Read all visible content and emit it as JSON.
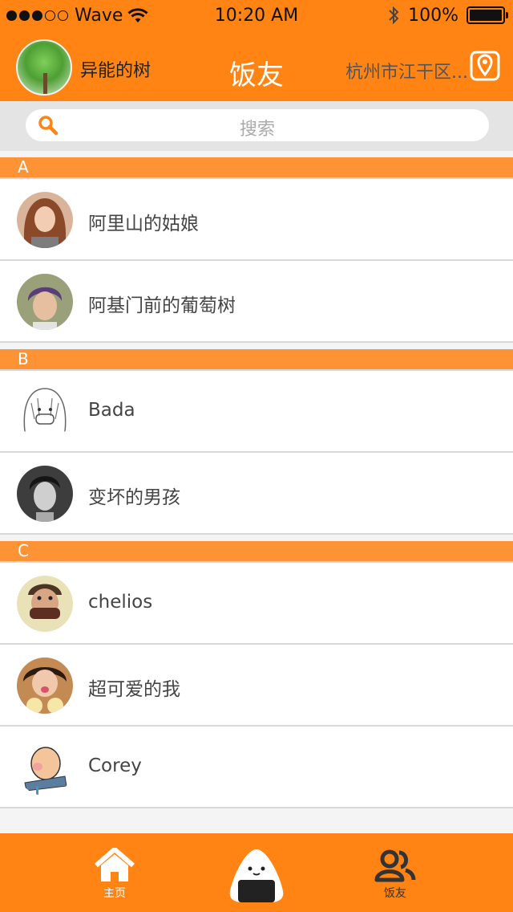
{
  "status_bar": {
    "carrier": "Wave",
    "time": "10:20  AM",
    "battery": "100%"
  },
  "nav": {
    "username": "异能的树",
    "title": "饭友",
    "location": "杭州市江干区..."
  },
  "search": {
    "placeholder": "搜索"
  },
  "sections": [
    {
      "letter": "A",
      "contacts": [
        "阿里山的姑娘",
        "阿基门前的葡萄树"
      ]
    },
    {
      "letter": "B",
      "contacts": [
        "Bada",
        "变坏的男孩"
      ]
    },
    {
      "letter": "C",
      "contacts": [
        "chelios",
        "超可爱的我",
        "Corey"
      ]
    }
  ],
  "tabbar": {
    "home_label": "主页",
    "friends_label": "饭友"
  },
  "colors": {
    "accent": "#ff8413",
    "section_header": "#fe9336"
  }
}
